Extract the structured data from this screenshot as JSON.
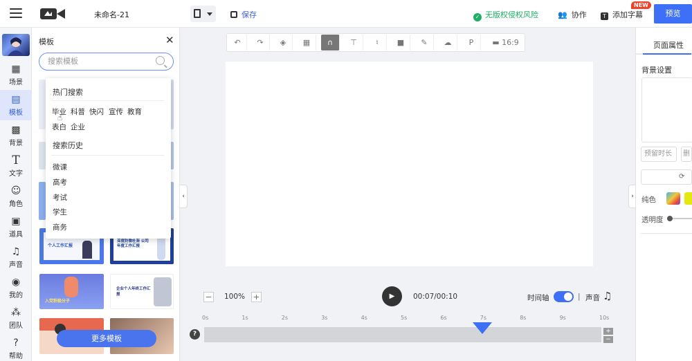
{
  "app": {
    "doc_name": "未命名-21",
    "save_label": "保存",
    "risk_label": "无版权侵权风险",
    "collab_label": "协作",
    "subtitle_label": "添加字幕",
    "new_badge": "NEW",
    "preview_label": "预览"
  },
  "sidebar": {
    "items": [
      {
        "label": "场景",
        "icon": "scene-icon"
      },
      {
        "label": "模板",
        "icon": "template-icon"
      },
      {
        "label": "背景",
        "icon": "background-icon"
      },
      {
        "label": "文字",
        "icon": "text-icon"
      },
      {
        "label": "角色",
        "icon": "character-icon"
      },
      {
        "label": "道具",
        "icon": "prop-icon"
      },
      {
        "label": "声音",
        "icon": "sound-icon"
      },
      {
        "label": "我的",
        "icon": "user-icon"
      },
      {
        "label": "团队",
        "icon": "team-icon"
      },
      {
        "label": "帮助",
        "icon": "help-icon"
      }
    ]
  },
  "panel": {
    "title": "模板",
    "search_placeholder": "搜索模板",
    "more_label": "更多模板",
    "thumbs": [
      {
        "text": "个人工作汇报",
        "colors": [
          "#4a78e8",
          "#f5f7fd"
        ]
      },
      {
        "text": "深度防微杜渐 公司年度工作汇报",
        "colors": [
          "#1e3f9a",
          "#ffffff"
        ]
      },
      {
        "text": "入党积极分子",
        "colors": [
          "#6a7ce0",
          "#ef8a6a"
        ]
      },
      {
        "text": "企业个人年终工作汇报",
        "colors": [
          "#ffffff",
          "#7a86a8"
        ]
      },
      {
        "text": "",
        "colors": [
          "#e6684f",
          "#f5d8c8"
        ]
      },
      {
        "text": "",
        "colors": [
          "#8a6a5a",
          "#e8c8b0"
        ]
      }
    ]
  },
  "dropdown": {
    "hot_title": "热门搜索",
    "hot_row1": [
      "毕业",
      "科普",
      "快闪",
      "宣传",
      "教育"
    ],
    "hot_row2": [
      "表白",
      "企业"
    ],
    "history_title": "搜索历史",
    "history": [
      "微课",
      "高考",
      "考试",
      "学生",
      "商务"
    ]
  },
  "editor": {
    "tools": [
      "undo-icon",
      "redo-icon",
      "layers-icon",
      "grid-icon",
      "magnet-icon",
      "brush-icon",
      "mic-icon",
      "camera-icon",
      "pen-icon",
      "cloud-icon",
      "p-icon",
      "ratio-icon"
    ],
    "ratio": "16:9",
    "zoom": "100%",
    "time": "00:07/00:10",
    "timeline_label": "时间轴",
    "timeline_on": true,
    "sep": "|",
    "sound_label": "声音",
    "ticks": [
      "0s",
      "1s",
      "2s",
      "3s",
      "4s",
      "5s",
      "6s",
      "7s",
      "8s",
      "9s",
      "10s"
    ],
    "playhead_seconds": 7,
    "duration_seconds": 10,
    "accent": "#3d6ff7"
  },
  "right_panel": {
    "tab": "页面属性",
    "bg_title": "背景设置",
    "btn1": "预留时长",
    "btn2": "删",
    "solid_label": "纯色",
    "opacity_label": "透明度"
  }
}
